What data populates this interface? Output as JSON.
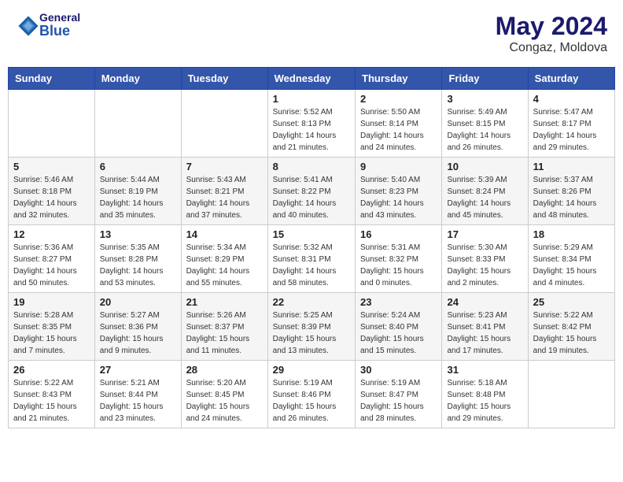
{
  "header": {
    "logo_general": "General",
    "logo_blue": "Blue",
    "month_year": "May 2024",
    "location": "Congaz, Moldova"
  },
  "days_of_week": [
    "Sunday",
    "Monday",
    "Tuesday",
    "Wednesday",
    "Thursday",
    "Friday",
    "Saturday"
  ],
  "weeks": [
    [
      {
        "day": "",
        "info": ""
      },
      {
        "day": "",
        "info": ""
      },
      {
        "day": "",
        "info": ""
      },
      {
        "day": "1",
        "info": "Sunrise: 5:52 AM\nSunset: 8:13 PM\nDaylight: 14 hours\nand 21 minutes."
      },
      {
        "day": "2",
        "info": "Sunrise: 5:50 AM\nSunset: 8:14 PM\nDaylight: 14 hours\nand 24 minutes."
      },
      {
        "day": "3",
        "info": "Sunrise: 5:49 AM\nSunset: 8:15 PM\nDaylight: 14 hours\nand 26 minutes."
      },
      {
        "day": "4",
        "info": "Sunrise: 5:47 AM\nSunset: 8:17 PM\nDaylight: 14 hours\nand 29 minutes."
      }
    ],
    [
      {
        "day": "5",
        "info": "Sunrise: 5:46 AM\nSunset: 8:18 PM\nDaylight: 14 hours\nand 32 minutes."
      },
      {
        "day": "6",
        "info": "Sunrise: 5:44 AM\nSunset: 8:19 PM\nDaylight: 14 hours\nand 35 minutes."
      },
      {
        "day": "7",
        "info": "Sunrise: 5:43 AM\nSunset: 8:21 PM\nDaylight: 14 hours\nand 37 minutes."
      },
      {
        "day": "8",
        "info": "Sunrise: 5:41 AM\nSunset: 8:22 PM\nDaylight: 14 hours\nand 40 minutes."
      },
      {
        "day": "9",
        "info": "Sunrise: 5:40 AM\nSunset: 8:23 PM\nDaylight: 14 hours\nand 43 minutes."
      },
      {
        "day": "10",
        "info": "Sunrise: 5:39 AM\nSunset: 8:24 PM\nDaylight: 14 hours\nand 45 minutes."
      },
      {
        "day": "11",
        "info": "Sunrise: 5:37 AM\nSunset: 8:26 PM\nDaylight: 14 hours\nand 48 minutes."
      }
    ],
    [
      {
        "day": "12",
        "info": "Sunrise: 5:36 AM\nSunset: 8:27 PM\nDaylight: 14 hours\nand 50 minutes."
      },
      {
        "day": "13",
        "info": "Sunrise: 5:35 AM\nSunset: 8:28 PM\nDaylight: 14 hours\nand 53 minutes."
      },
      {
        "day": "14",
        "info": "Sunrise: 5:34 AM\nSunset: 8:29 PM\nDaylight: 14 hours\nand 55 minutes."
      },
      {
        "day": "15",
        "info": "Sunrise: 5:32 AM\nSunset: 8:31 PM\nDaylight: 14 hours\nand 58 minutes."
      },
      {
        "day": "16",
        "info": "Sunrise: 5:31 AM\nSunset: 8:32 PM\nDaylight: 15 hours\nand 0 minutes."
      },
      {
        "day": "17",
        "info": "Sunrise: 5:30 AM\nSunset: 8:33 PM\nDaylight: 15 hours\nand 2 minutes."
      },
      {
        "day": "18",
        "info": "Sunrise: 5:29 AM\nSunset: 8:34 PM\nDaylight: 15 hours\nand 4 minutes."
      }
    ],
    [
      {
        "day": "19",
        "info": "Sunrise: 5:28 AM\nSunset: 8:35 PM\nDaylight: 15 hours\nand 7 minutes."
      },
      {
        "day": "20",
        "info": "Sunrise: 5:27 AM\nSunset: 8:36 PM\nDaylight: 15 hours\nand 9 minutes."
      },
      {
        "day": "21",
        "info": "Sunrise: 5:26 AM\nSunset: 8:37 PM\nDaylight: 15 hours\nand 11 minutes."
      },
      {
        "day": "22",
        "info": "Sunrise: 5:25 AM\nSunset: 8:39 PM\nDaylight: 15 hours\nand 13 minutes."
      },
      {
        "day": "23",
        "info": "Sunrise: 5:24 AM\nSunset: 8:40 PM\nDaylight: 15 hours\nand 15 minutes."
      },
      {
        "day": "24",
        "info": "Sunrise: 5:23 AM\nSunset: 8:41 PM\nDaylight: 15 hours\nand 17 minutes."
      },
      {
        "day": "25",
        "info": "Sunrise: 5:22 AM\nSunset: 8:42 PM\nDaylight: 15 hours\nand 19 minutes."
      }
    ],
    [
      {
        "day": "26",
        "info": "Sunrise: 5:22 AM\nSunset: 8:43 PM\nDaylight: 15 hours\nand 21 minutes."
      },
      {
        "day": "27",
        "info": "Sunrise: 5:21 AM\nSunset: 8:44 PM\nDaylight: 15 hours\nand 23 minutes."
      },
      {
        "day": "28",
        "info": "Sunrise: 5:20 AM\nSunset: 8:45 PM\nDaylight: 15 hours\nand 24 minutes."
      },
      {
        "day": "29",
        "info": "Sunrise: 5:19 AM\nSunset: 8:46 PM\nDaylight: 15 hours\nand 26 minutes."
      },
      {
        "day": "30",
        "info": "Sunrise: 5:19 AM\nSunset: 8:47 PM\nDaylight: 15 hours\nand 28 minutes."
      },
      {
        "day": "31",
        "info": "Sunrise: 5:18 AM\nSunset: 8:48 PM\nDaylight: 15 hours\nand 29 minutes."
      },
      {
        "day": "",
        "info": ""
      }
    ]
  ]
}
